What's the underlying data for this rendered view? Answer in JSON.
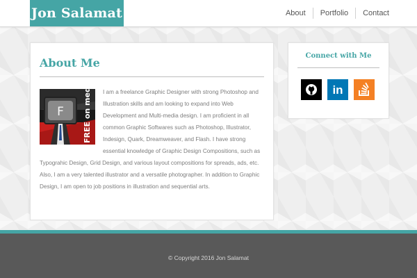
{
  "brand": {
    "name": "Jon Salamat",
    "color": "#45a5a5"
  },
  "nav": [
    {
      "label": "About"
    },
    {
      "label": "Portfolio"
    },
    {
      "label": "Contact"
    }
  ],
  "about": {
    "title": "About Me",
    "photo_text": "FREE on media",
    "photo_letter": "F",
    "body": "I am a freelance Graphic Designer with strong Photoshop and Illustration skills and am looking to expand into Web Development and Multi-media design. I am proficient in all common Graphic Softwares such as Photoshop, Illustrator, Indesign, Quark, Dreamweaver, and Flash. I have strong essential knowledge of Graphic Design Compositions, such as Typograhic Design, Grid Design, and various layout compositions for spreads, ads, etc. Also, I am a very talented illustrator and a versatile photographer. In addition to Graphic Design, I am open to job positions in illustration and sequential arts."
  },
  "connect": {
    "title": "Connect with Me",
    "links": [
      {
        "icon": "github-icon",
        "color": "#000000"
      },
      {
        "icon": "linkedin-icon",
        "label": "in",
        "color": "#0077b5"
      },
      {
        "icon": "stackoverflow-icon",
        "color": "#f48024"
      }
    ]
  },
  "footer": {
    "copyright": "© Copyright 2016 Jon Salamat"
  }
}
